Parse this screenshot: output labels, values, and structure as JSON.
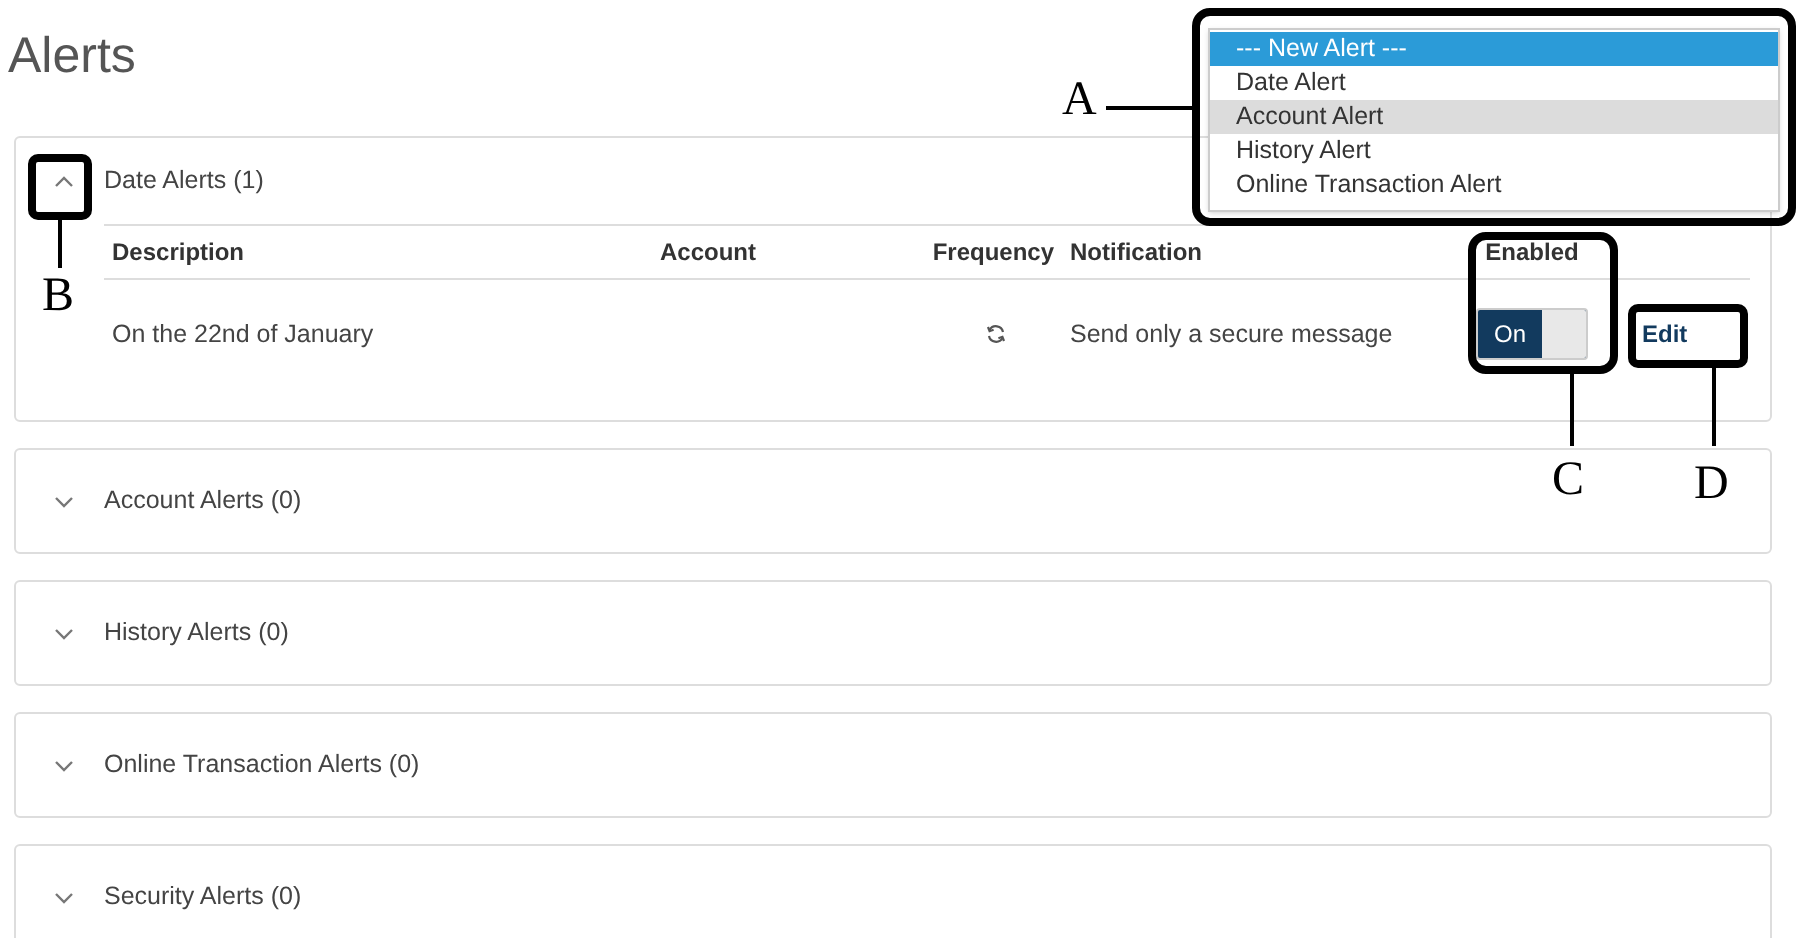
{
  "title": "Alerts",
  "new_alert_list": [
    {
      "label": "--- New Alert ---",
      "selected": true,
      "hovered": false
    },
    {
      "label": "Date Alert",
      "selected": false,
      "hovered": false
    },
    {
      "label": "Account Alert",
      "selected": false,
      "hovered": true
    },
    {
      "label": "History Alert",
      "selected": false,
      "hovered": false
    },
    {
      "label": "Online Transaction Alert",
      "selected": false,
      "hovered": false
    }
  ],
  "panels": [
    {
      "title": "Date Alerts (1)",
      "expanded": true,
      "columns": [
        "Description",
        "Account",
        "Frequency",
        "Notification",
        "Enabled"
      ],
      "rows": [
        {
          "description": "On the 22nd of January",
          "notification": "Send only a secure message",
          "enabled": {
            "on": true,
            "label": "On"
          },
          "action": "Edit"
        }
      ]
    },
    {
      "title": "Account Alerts (0)",
      "expanded": false
    },
    {
      "title": "History Alerts (0)",
      "expanded": false
    },
    {
      "title": "Online Transaction Alerts (0)",
      "expanded": false
    },
    {
      "title": "Security Alerts (0)",
      "expanded": false
    }
  ],
  "annotations": [
    {
      "label": "A"
    },
    {
      "label": "B"
    },
    {
      "label": "C"
    },
    {
      "label": "D"
    }
  ]
}
